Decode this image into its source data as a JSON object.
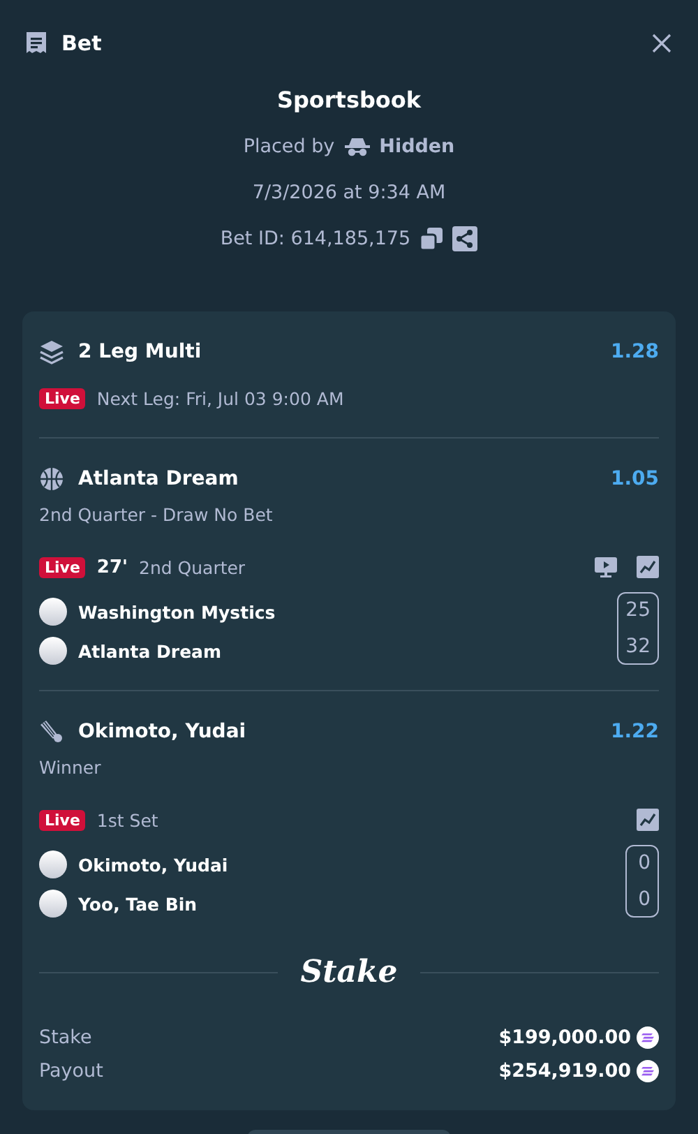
{
  "header": {
    "title": "Bet"
  },
  "summary": {
    "title": "Sportsbook",
    "placed_by_label": "Placed by",
    "placed_by_user": "Hidden",
    "datetime": "7/3/2026 at 9:34 AM",
    "bet_id": "Bet ID: 614,185,175"
  },
  "multi": {
    "title": "2 Leg Multi",
    "odds": "1.28",
    "live_badge": "Live",
    "next_leg": "Next Leg: Fri, Jul 03 9:00 AM"
  },
  "legs": [
    {
      "kind": "basketball",
      "title": "Atlanta Dream",
      "odds": "1.05",
      "market": "2nd Quarter - Draw No Bet",
      "live_badge": "Live",
      "clock": "27'",
      "period": "2nd Quarter",
      "tools": [
        {
          "kind": "stream"
        },
        {
          "kind": "stats"
        }
      ],
      "competitors": [
        {
          "name": "Washington Mystics",
          "score": "25"
        },
        {
          "name": "Atlanta Dream",
          "score": "32"
        }
      ]
    },
    {
      "kind": "badminton",
      "title": "Okimoto, Yudai",
      "odds": "1.22",
      "market": "Winner",
      "live_badge": "Live",
      "period": "1st Set",
      "tools": [
        {
          "kind": "stats"
        }
      ],
      "competitors": [
        {
          "name": "Okimoto, Yudai",
          "score": "0"
        },
        {
          "name": "Yoo, Tae Bin",
          "score": "0"
        }
      ]
    }
  ],
  "brand": "Stake",
  "totals": [
    {
      "label": "Stake",
      "amount": "$199,000.00"
    },
    {
      "label": "Payout",
      "amount": "$254,919.00"
    }
  ]
}
